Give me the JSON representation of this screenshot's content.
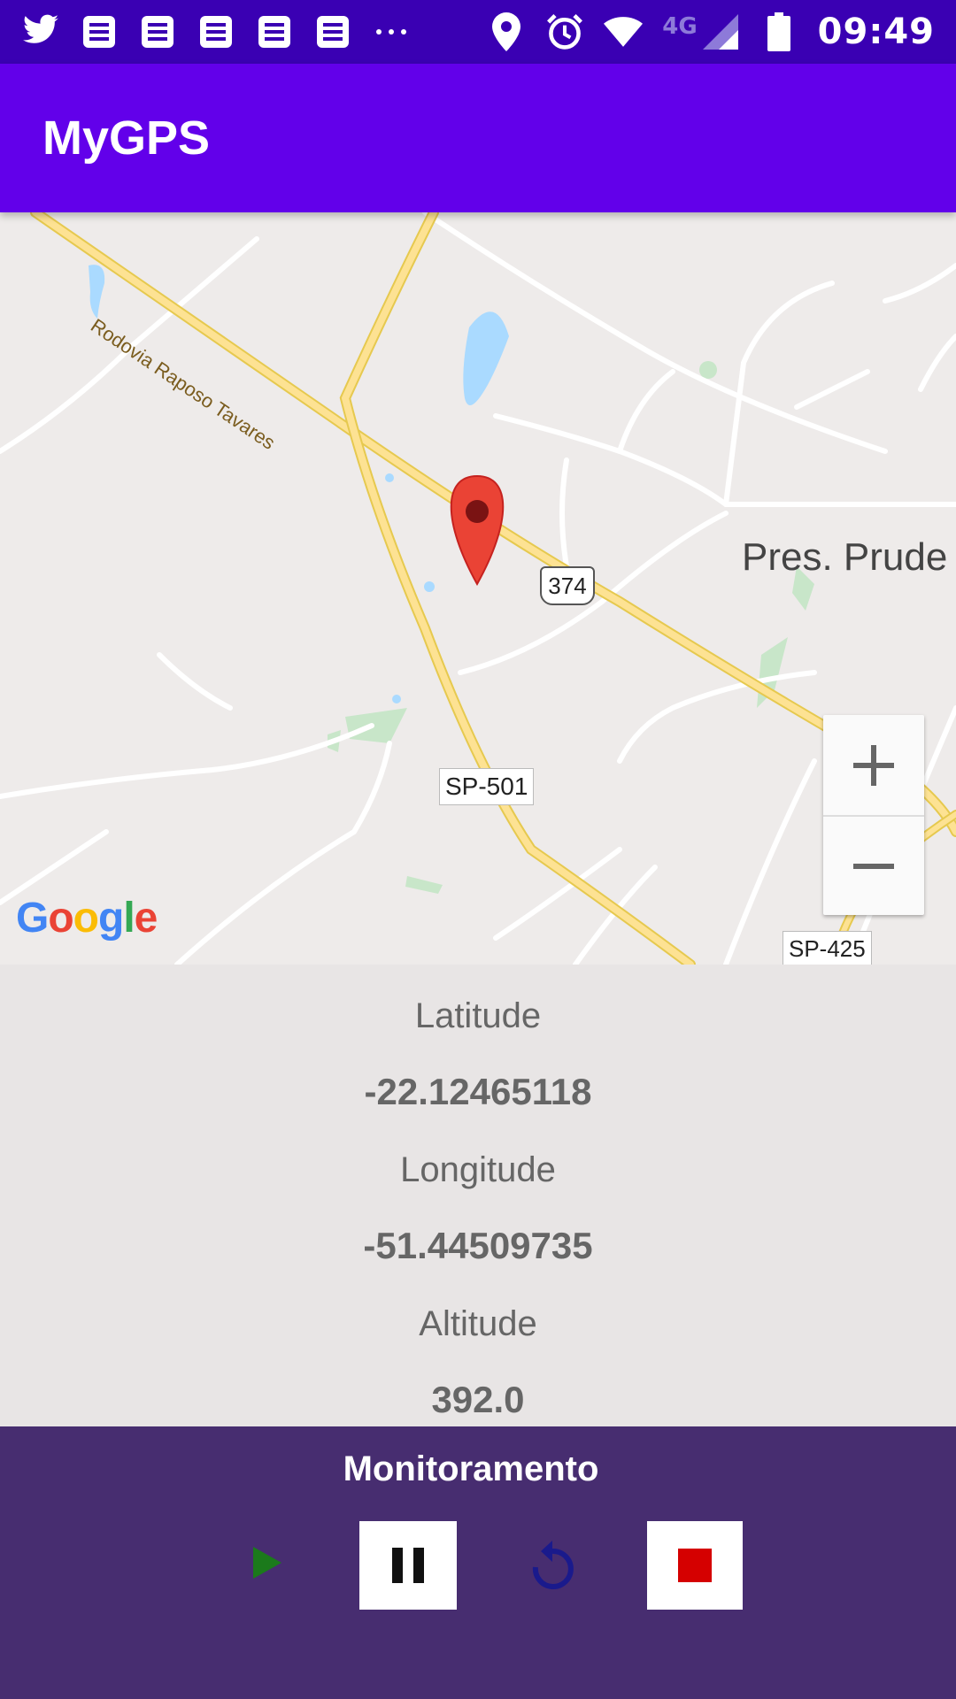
{
  "status_bar": {
    "time": "09:49",
    "network": "4G",
    "left_icons": [
      "twitter-icon",
      "notification-icon",
      "notification-icon",
      "notification-icon",
      "notification-icon",
      "notification-icon",
      "more-icon"
    ],
    "right_icons": [
      "location-icon",
      "alarm-icon",
      "wifi-icon",
      "signal-icon",
      "battery-icon"
    ]
  },
  "app_bar": {
    "title": "MyGPS"
  },
  "map": {
    "labels": {
      "road_name": "Rodovia Raposo Tavares",
      "city": "Pres. Prude",
      "shield_374": "374",
      "sp501": "SP-501",
      "sp425": "SP-425"
    },
    "google_logo": [
      "G",
      "o",
      "o",
      "g",
      "l",
      "e"
    ],
    "marker_icon": "map-pin-icon"
  },
  "info": {
    "latitude_label": "Latitude",
    "latitude_value": "-22.12465118",
    "longitude_label": "Longitude",
    "longitude_value": "-51.44509735",
    "altitude_label": "Altitude",
    "altitude_value": "392.0"
  },
  "monitor": {
    "title": "Monitoramento",
    "controls": [
      "play-icon",
      "pause-icon",
      "restart-icon",
      "stop-icon"
    ]
  },
  "colors": {
    "status_bar": "#3a00b3",
    "app_bar": "#6200ea",
    "monitor_bg": "#472d70",
    "play": "#1b7a1b",
    "stop": "#d50000",
    "restart": "#1a1a8c",
    "marker": "#ea4335"
  }
}
